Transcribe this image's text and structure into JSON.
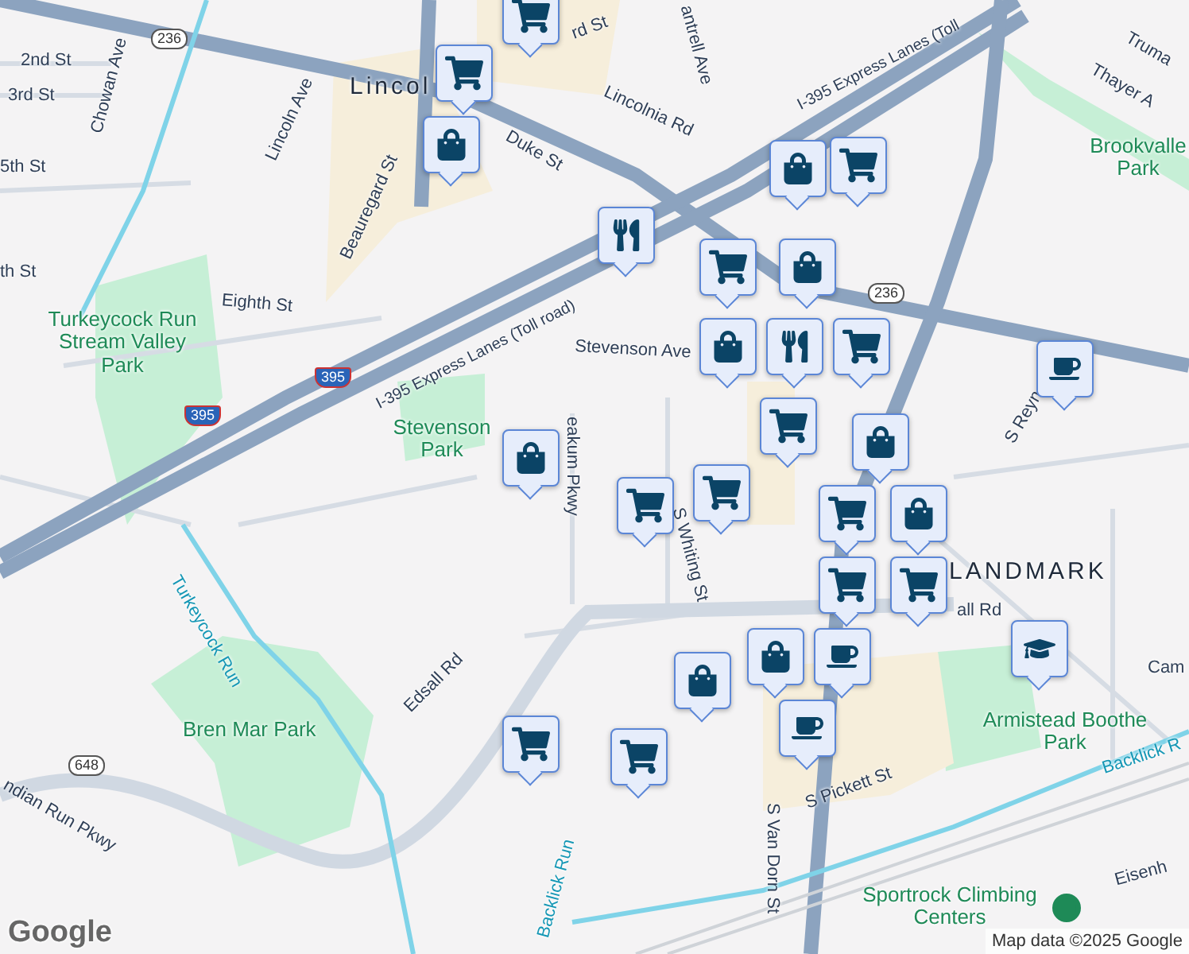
{
  "map": {
    "labels": [
      {
        "text": "rd St",
        "kind": "street"
      },
      {
        "text": "2nd St",
        "kind": "street"
      },
      {
        "text": "3rd St",
        "kind": "street"
      },
      {
        "text": "5th St",
        "kind": "street"
      },
      {
        "text": "th St",
        "kind": "street"
      },
      {
        "text": "Chowan Ave",
        "kind": "street"
      },
      {
        "text": "Lincoln Ave",
        "kind": "street"
      },
      {
        "text": "Lincol",
        "kind": "area"
      },
      {
        "text": "Beauregard St",
        "kind": "street"
      },
      {
        "text": "Duke St",
        "kind": "street"
      },
      {
        "text": "Eighth St",
        "kind": "street"
      },
      {
        "text": "I-395 Express Lanes (Toll road)",
        "kind": "street"
      },
      {
        "text": "I-395 Express Lanes (Toll",
        "kind": "street"
      },
      {
        "text": "Lincolnia Rd",
        "kind": "street"
      },
      {
        "text": "antrell Ave",
        "kind": "street"
      },
      {
        "text": "Stevenson Ave",
        "kind": "street"
      },
      {
        "text": "Turkeycock Run Stream Valley Park",
        "kind": "park"
      },
      {
        "text": "Stevenson Park",
        "kind": "park"
      },
      {
        "text": "eakum Pkwy",
        "kind": "street"
      },
      {
        "text": "Truma",
        "kind": "street"
      },
      {
        "text": "Thayer A",
        "kind": "street"
      },
      {
        "text": "Brookvalle Park",
        "kind": "park"
      },
      {
        "text": "S Reyn",
        "kind": "street"
      },
      {
        "text": "S Whiting St",
        "kind": "street"
      },
      {
        "text": "S Van Dorn St",
        "kind": "street"
      },
      {
        "text": "LANDMARK",
        "kind": "area"
      },
      {
        "text": "Edsall Rd",
        "kind": "street"
      },
      {
        "text": "all Rd",
        "kind": "street"
      },
      {
        "text": "Turkeycock Run",
        "kind": "water"
      },
      {
        "text": "Bren Mar Park",
        "kind": "park"
      },
      {
        "text": "ndian Run Pkwy",
        "kind": "street"
      },
      {
        "text": "Armistead Boothe Park",
        "kind": "park"
      },
      {
        "text": "S Pickett St",
        "kind": "street"
      },
      {
        "text": "Backlick Run",
        "kind": "water"
      },
      {
        "text": "Backlick R",
        "kind": "water"
      },
      {
        "text": "Cam",
        "kind": "street"
      },
      {
        "text": "Eisenh",
        "kind": "street"
      },
      {
        "text": "236",
        "kind": "shield"
      },
      {
        "text": "236",
        "kind": "shield"
      },
      {
        "text": "395",
        "kind": "interstate"
      },
      {
        "text": "395",
        "kind": "interstate"
      },
      {
        "text": "648",
        "kind": "shield"
      }
    ],
    "pins": [
      {
        "kind": "cart"
      },
      {
        "kind": "cart"
      },
      {
        "kind": "bag"
      },
      {
        "kind": "bag"
      },
      {
        "kind": "cart"
      },
      {
        "kind": "fork"
      },
      {
        "kind": "cart"
      },
      {
        "kind": "bag"
      },
      {
        "kind": "bag"
      },
      {
        "kind": "fork"
      },
      {
        "kind": "cart"
      },
      {
        "kind": "cart"
      },
      {
        "kind": "bag"
      },
      {
        "kind": "cup"
      },
      {
        "kind": "bag"
      },
      {
        "kind": "cart"
      },
      {
        "kind": "cart"
      },
      {
        "kind": "cart"
      },
      {
        "kind": "bag"
      },
      {
        "kind": "cart"
      },
      {
        "kind": "cart"
      },
      {
        "kind": "bag"
      },
      {
        "kind": "cup"
      },
      {
        "kind": "cup"
      },
      {
        "kind": "bag"
      },
      {
        "kind": "cart"
      },
      {
        "kind": "cart"
      },
      {
        "kind": "cap"
      }
    ],
    "place": {
      "name": "Sportrock Climbing Centers"
    }
  },
  "attribution": {
    "logo": "Google",
    "text": "Map data ©2025 Google"
  }
}
